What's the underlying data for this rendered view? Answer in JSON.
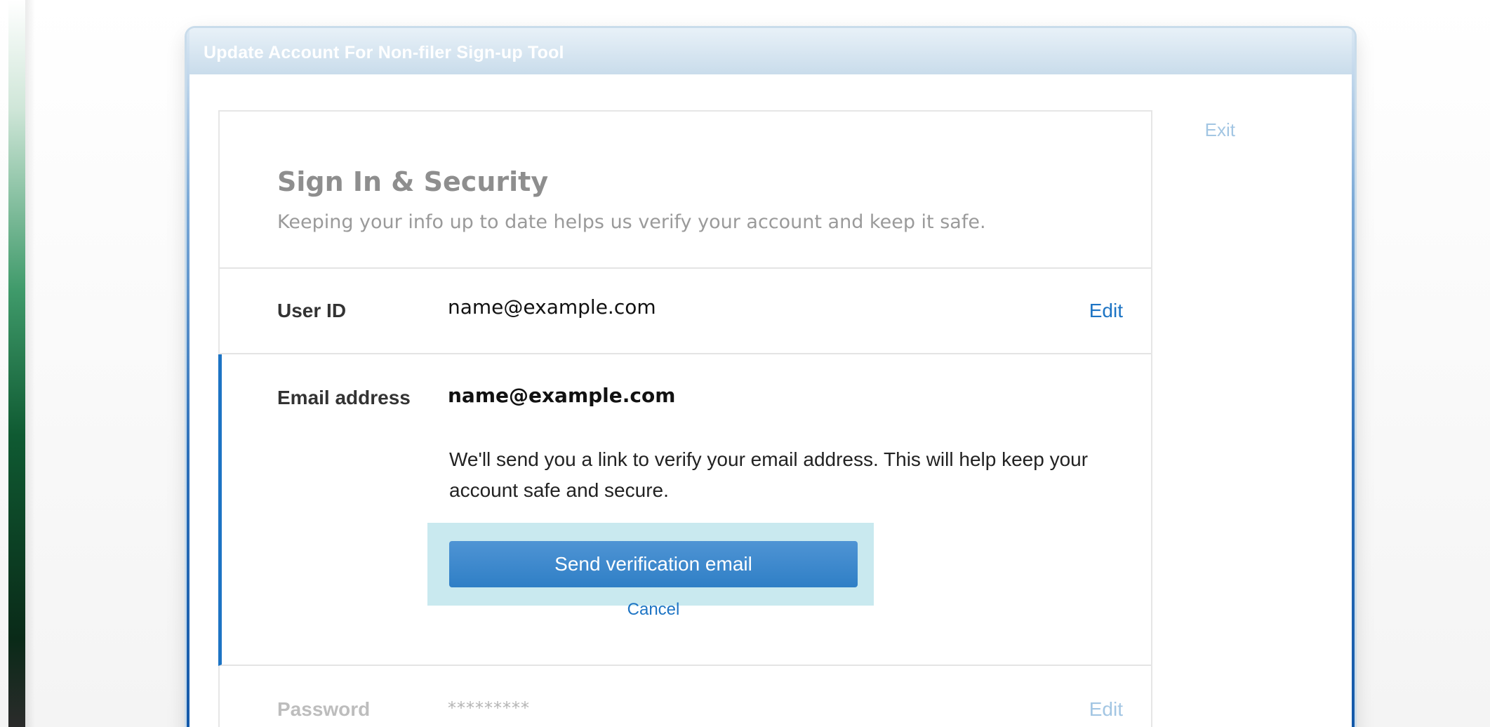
{
  "window": {
    "title": "Update Account For Non-filer Sign-up Tool",
    "exit_label": "Exit"
  },
  "card": {
    "title": "Sign In & Security",
    "subtitle": "Keeping your info up to date helps us verify your account and keep it safe."
  },
  "user_id": {
    "label": "User ID",
    "value": "name@example.com",
    "edit_label": "Edit"
  },
  "email": {
    "label": "Email address",
    "value": "name@example.com",
    "description": "We'll send you a link to verify your email address. This will help keep your account safe and secure.",
    "send_button_label": "Send verification email",
    "cancel_label": "Cancel"
  },
  "password": {
    "label": "Password",
    "value": "*********",
    "edit_label": "Edit"
  },
  "colors": {
    "accent": "#1d74c4",
    "button": "#3a86cb",
    "focus_ring": "#c9e9ef",
    "header_bar": "#c9dceb"
  }
}
